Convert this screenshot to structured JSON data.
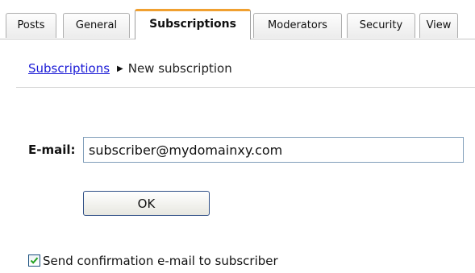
{
  "tabs": [
    {
      "label": "Posts",
      "active": false
    },
    {
      "label": "General",
      "active": false
    },
    {
      "label": "Subscriptions",
      "active": true
    },
    {
      "label": "Moderators",
      "active": false
    },
    {
      "label": "Security",
      "active": false
    },
    {
      "label": "View",
      "active": false
    }
  ],
  "breadcrumb": {
    "link": "Subscriptions",
    "separator_icon": "triangle-right-icon",
    "current": "New subscription"
  },
  "form": {
    "email_label": "E-mail:",
    "email_value": "subscriber@mydomainxy.com",
    "ok_label": "OK",
    "confirm_checked": true,
    "confirm_label": "Send confirmation e-mail to subscriber"
  },
  "colors": {
    "active_tab_accent": "#f0a030",
    "link": "#1a1ad6",
    "checkmark": "#21a121"
  }
}
